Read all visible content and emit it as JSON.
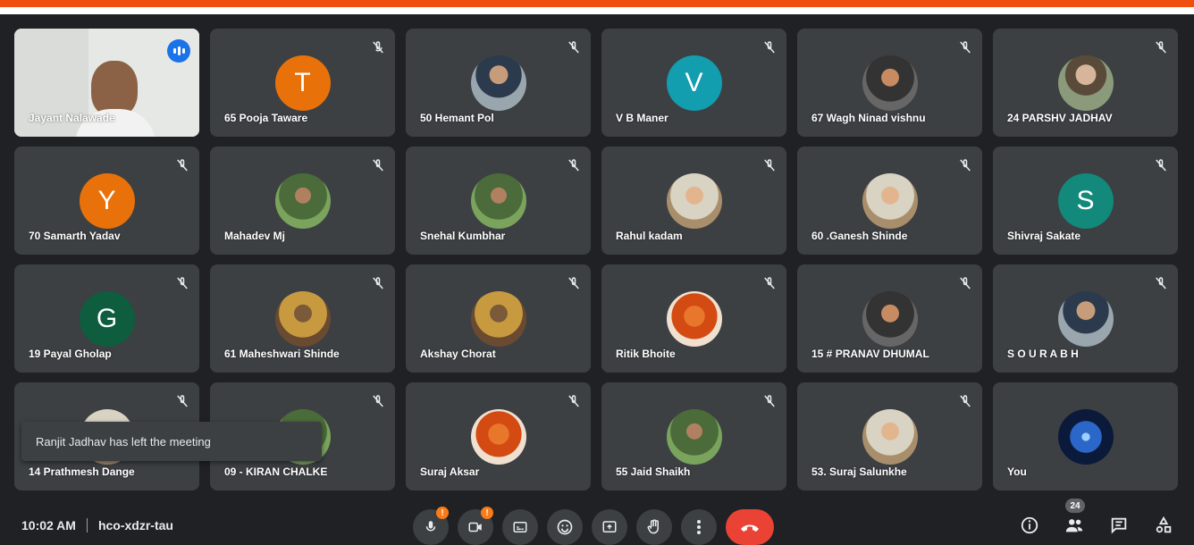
{
  "participants": [
    {
      "name": "Jayant Nalawade"
    },
    {
      "name": "65 Pooja Taware",
      "initial": "T",
      "color": "#e8710a"
    },
    {
      "name": "50 Hemant Pol"
    },
    {
      "name": "V B Maner",
      "initial": "V",
      "color": "#129eaf"
    },
    {
      "name": "67 Wagh Ninad vishnu"
    },
    {
      "name": "24 PARSHV JADHAV"
    },
    {
      "name": "70 Samarth Yadav",
      "initial": "Y",
      "color": "#e8710a"
    },
    {
      "name": "Mahadev Mj"
    },
    {
      "name": "Snehal Kumbhar"
    },
    {
      "name": "Rahul kadam"
    },
    {
      "name": "60 .Ganesh Shinde"
    },
    {
      "name": "Shivraj Sakate",
      "initial": "S",
      "color": "#12897a"
    },
    {
      "name": "19 Payal Gholap",
      "initial": "G",
      "color": "#0d5d3e"
    },
    {
      "name": "61 Maheshwari Shinde"
    },
    {
      "name": "Akshay Chorat"
    },
    {
      "name": "Ritik Bhoite"
    },
    {
      "name": "15 # PRANAV DHUMAL"
    },
    {
      "name": "S O U R A B H"
    },
    {
      "name": "14 Prathmesh Dange"
    },
    {
      "name": "09 - KIRAN CHALKE"
    },
    {
      "name": "Suraj Aksar"
    },
    {
      "name": "55 Jaid Shaikh"
    },
    {
      "name": "53. Suraj Salunkhe"
    },
    {
      "name": "You"
    }
  ],
  "toast": {
    "text": "Ranjit Jadhav has left the meeting"
  },
  "bottom": {
    "time": "10:02 AM",
    "meeting_code": "hco-xdzr-tau",
    "people_count": "24"
  },
  "colors": {
    "accent": "#1a73e8",
    "end_call": "#ea4335",
    "brand_strip": "#f04e0f"
  }
}
